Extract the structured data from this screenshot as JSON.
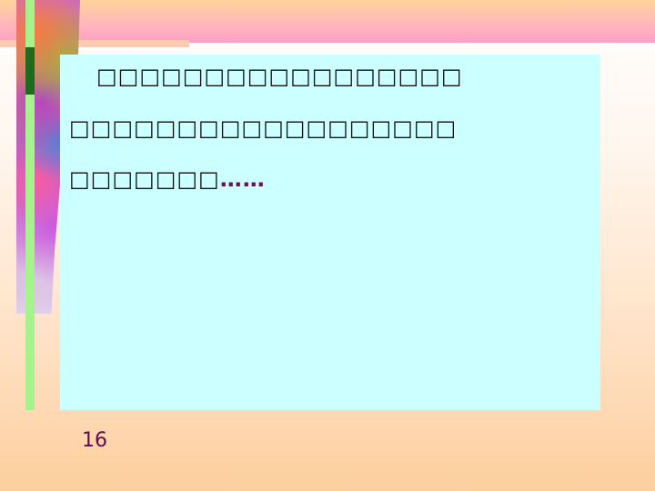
{
  "slide": {
    "body_lines": [
      "□□□□□□□□□□□□□□□□□",
      "□□□□□□□□□□□□□□□□□□",
      "□□□□□□□"
    ],
    "ellipsis": "……",
    "page_number": "16"
  },
  "colors": {
    "content_background": "#ccffff",
    "accent_green": "#a6f28c",
    "accent_dark_green": "#1e6b1e",
    "page_number": "#5c0a4f"
  }
}
